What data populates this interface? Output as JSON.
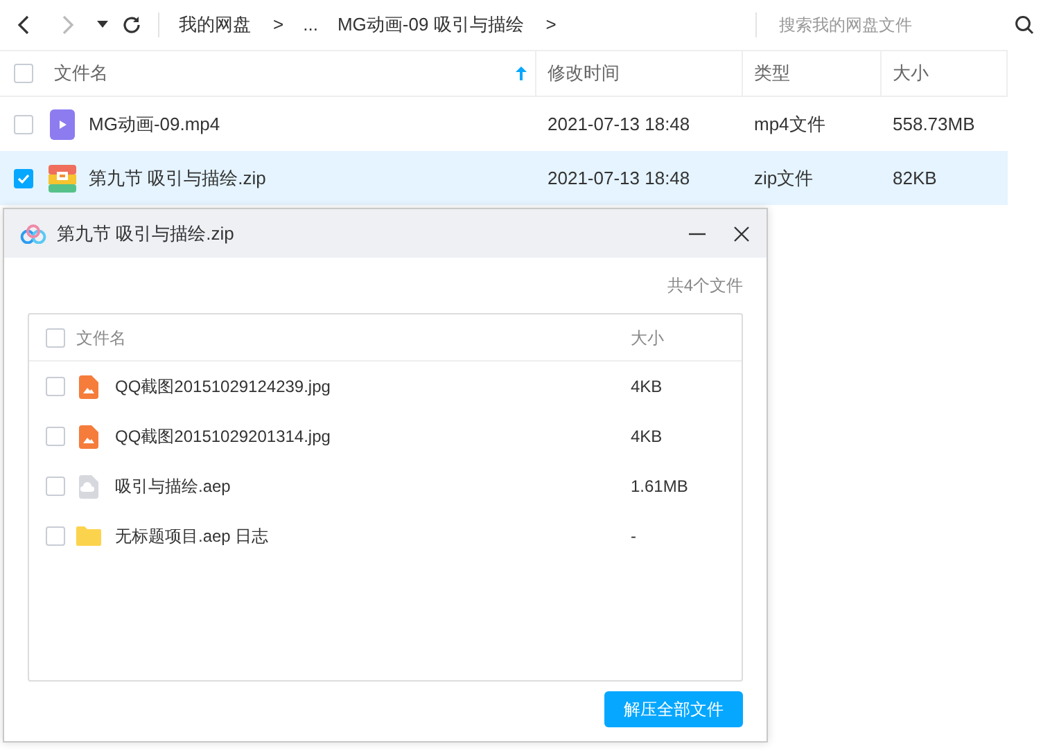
{
  "toolbar": {
    "breadcrumbs": [
      {
        "label": "我的网盘",
        "separator": ">"
      },
      {
        "label": "..."
      },
      {
        "label": "MG动画-09 吸引与描绘",
        "separator": ">"
      }
    ],
    "search": {
      "placeholder": "搜索我的网盘文件"
    }
  },
  "table": {
    "header_checked": false,
    "columns": [
      "文件名",
      "修改时间",
      "类型",
      "大小"
    ],
    "rows": [
      {
        "kind": "video",
        "name": "MG动画-09.mp4",
        "modified": "2021-07-13 18:48",
        "type": "mp4文件",
        "size": "558.73MB",
        "checked": false,
        "selected": false
      },
      {
        "kind": "zip",
        "name": "第九节 吸引与描绘.zip",
        "modified": "2021-07-13 18:48",
        "type": "zip文件",
        "size": "82KB",
        "checked": true,
        "selected": true
      }
    ]
  },
  "dialog": {
    "title": "第九节 吸引与描绘.zip",
    "count": "共4个文件",
    "header_checked": false,
    "columns": [
      "文件名",
      "大小"
    ],
    "files": [
      {
        "kind": "image",
        "name": "QQ截图20151029124239.jpg",
        "size": "4KB",
        "checked": false
      },
      {
        "kind": "image",
        "name": "QQ截图20151029201314.jpg",
        "size": "4KB",
        "checked": false
      },
      {
        "kind": "file",
        "name": "吸引与描绘.aep",
        "size": "1.61MB",
        "checked": false
      },
      {
        "kind": "folder",
        "name": "无标题项目.aep 日志",
        "size": "-",
        "checked": false
      }
    ],
    "button": "解压全部文件"
  }
}
